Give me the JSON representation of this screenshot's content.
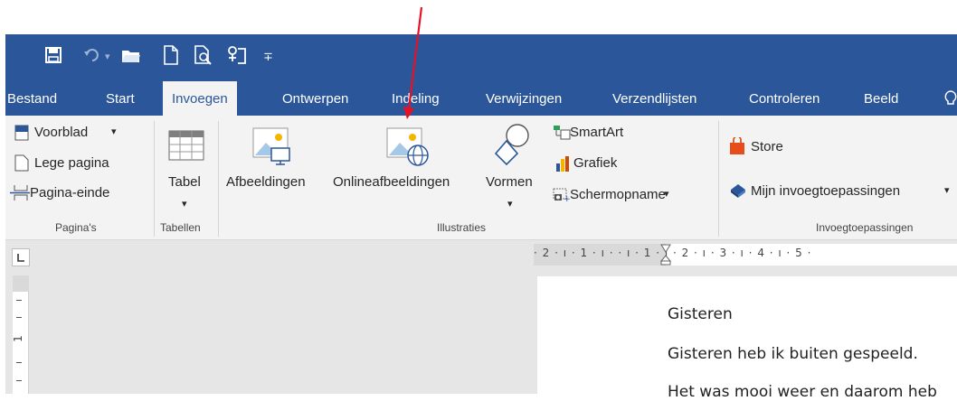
{
  "quick_access": {
    "save_icon": "save-icon",
    "undo_icon": "undo-icon",
    "undo_dropdown": "▾",
    "open_icon": "folder-icon",
    "new_icon": "new-document-icon",
    "print_preview_icon": "print-preview-icon",
    "touch_mode_icon": "touch-mode-icon",
    "customize": "∓"
  },
  "tabs": [
    {
      "label": "Bestand"
    },
    {
      "label": "Start"
    },
    {
      "label": "Invoegen"
    },
    {
      "label": "Ontwerpen"
    },
    {
      "label": "Indeling"
    },
    {
      "label": "Verwijzingen"
    },
    {
      "label": "Verzendlijsten"
    },
    {
      "label": "Controleren"
    },
    {
      "label": "Beeld"
    }
  ],
  "active_tab": "Invoegen",
  "ribbon": {
    "pages": {
      "voorblad": "Voorblad",
      "lege_pagina": "Lege pagina",
      "pagina_einde": "Pagina-einde",
      "group": "Pagina's"
    },
    "tables": {
      "tabel": "Tabel",
      "group": "Tabellen"
    },
    "illustrations": {
      "afbeeldingen": "Afbeeldingen",
      "online": "Onlineafbeeldingen",
      "vormen": "Vormen",
      "smartart": "SmartArt",
      "grafiek": "Grafiek",
      "schermopname": "Schermopname",
      "group": "Illustraties"
    },
    "addins": {
      "store": "Store",
      "mijn": "Mijn invoegtoepassingen",
      "group": "Invoegtoepassingen"
    }
  },
  "ruler": {
    "ticks": "· 2 · ı · 1 · ı ·   · ı · 1 · ı · 2 · ı · 3 · ı · 4 · ı · 5 ·",
    "vertical_number": "1"
  },
  "document": {
    "title": "Gisteren",
    "line1": "Gisteren heb ik buiten gespeeld.",
    "line2": "Het was mooi weer en daarom heb"
  },
  "colors": {
    "brand": "#2b579a",
    "arrow": "#e81123"
  }
}
